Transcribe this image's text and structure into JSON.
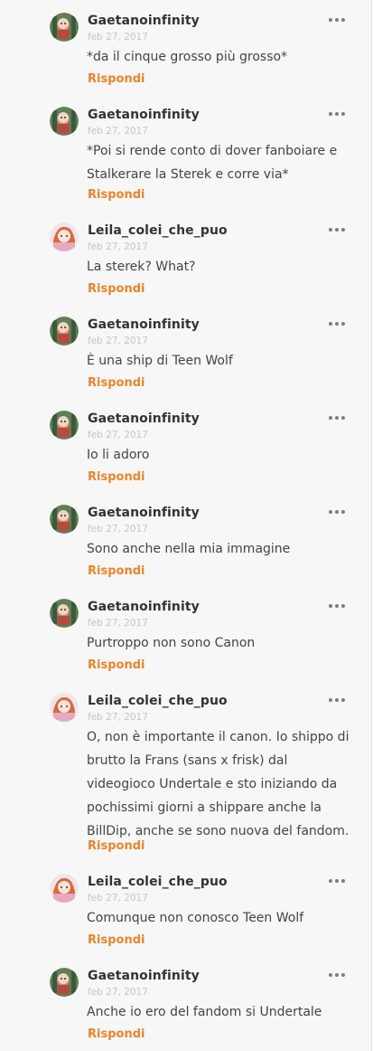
{
  "reply_label": "Rispondi",
  "colors": {
    "accent": "#e8852e",
    "author": "#333333",
    "date": "#c5c5c5",
    "text": "#444444",
    "background": "#f7f7f7"
  },
  "comments": [
    {
      "author": "Gaetanoinfinity",
      "date": "feb 27, 2017",
      "text": "*da il cinque grosso più grosso*",
      "avatar": "gaetano-avatar"
    },
    {
      "author": "Gaetanoinfinity",
      "date": "feb 27, 2017",
      "text": "*Poi si rende conto di dover fanboiare e Stalkerare la Sterek e corre via*",
      "avatar": "gaetano-avatar"
    },
    {
      "author": "Leila_colei_che_puo",
      "date": "feb 27, 2017",
      "text": "La sterek? What?",
      "avatar": "leila-avatar"
    },
    {
      "author": "Gaetanoinfinity",
      "date": "feb 27, 2017",
      "text": "È una ship di Teen Wolf",
      "avatar": "gaetano-avatar"
    },
    {
      "author": "Gaetanoinfinity",
      "date": "feb 27, 2017",
      "text": "Io li adoro",
      "avatar": "gaetano-avatar"
    },
    {
      "author": "Gaetanoinfinity",
      "date": "feb 27, 2017",
      "text": "Sono anche nella mia immagine",
      "avatar": "gaetano-avatar"
    },
    {
      "author": "Gaetanoinfinity",
      "date": "feb 27, 2017",
      "text": "Purtroppo non sono Canon",
      "avatar": "gaetano-avatar"
    },
    {
      "author": "Leila_colei_che_puo",
      "date": "feb 27, 2017",
      "text": "O, non è importante il canon. Io shippo di brutto la Frans (sans x frisk) dal videogioco Undertale e sto iniziando da pochissimi giorni a shippare anche la BillDip, anche se sono nuova del fandom.",
      "avatar": "leila-avatar"
    },
    {
      "author": "Leila_colei_che_puo",
      "date": "feb 27, 2017",
      "text": "Comunque non conosco Teen Wolf",
      "avatar": "leila-avatar"
    },
    {
      "author": "Gaetanoinfinity",
      "date": "feb 27, 2017",
      "text": "Anche io ero del fandom si Undertale",
      "avatar": "gaetano-avatar"
    }
  ]
}
